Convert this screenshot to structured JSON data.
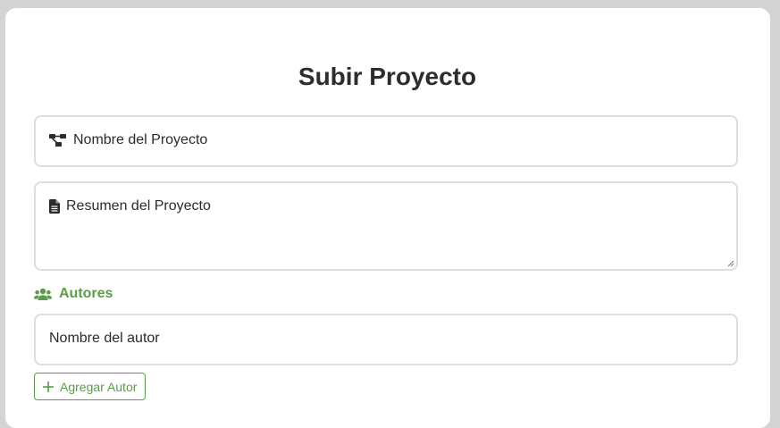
{
  "form": {
    "title": "Subir Proyecto",
    "project_name": {
      "placeholder": "Nombre del Proyecto",
      "icon": "project-diagram-icon"
    },
    "project_summary": {
      "placeholder": "Resumen del Proyecto",
      "icon": "file-text-icon"
    },
    "authors_section": {
      "label": "Autores",
      "icon": "users-icon"
    },
    "author_name": {
      "placeholder": "Nombre del autor"
    },
    "add_author_button": {
      "label": "Agregar Autor",
      "icon": "plus-icon"
    }
  },
  "colors": {
    "accent": "#5a9d4a",
    "border": "#dedede",
    "page_background": "#d4d4d4",
    "card_background": "#ffffff",
    "text": "#2b2b2b"
  }
}
